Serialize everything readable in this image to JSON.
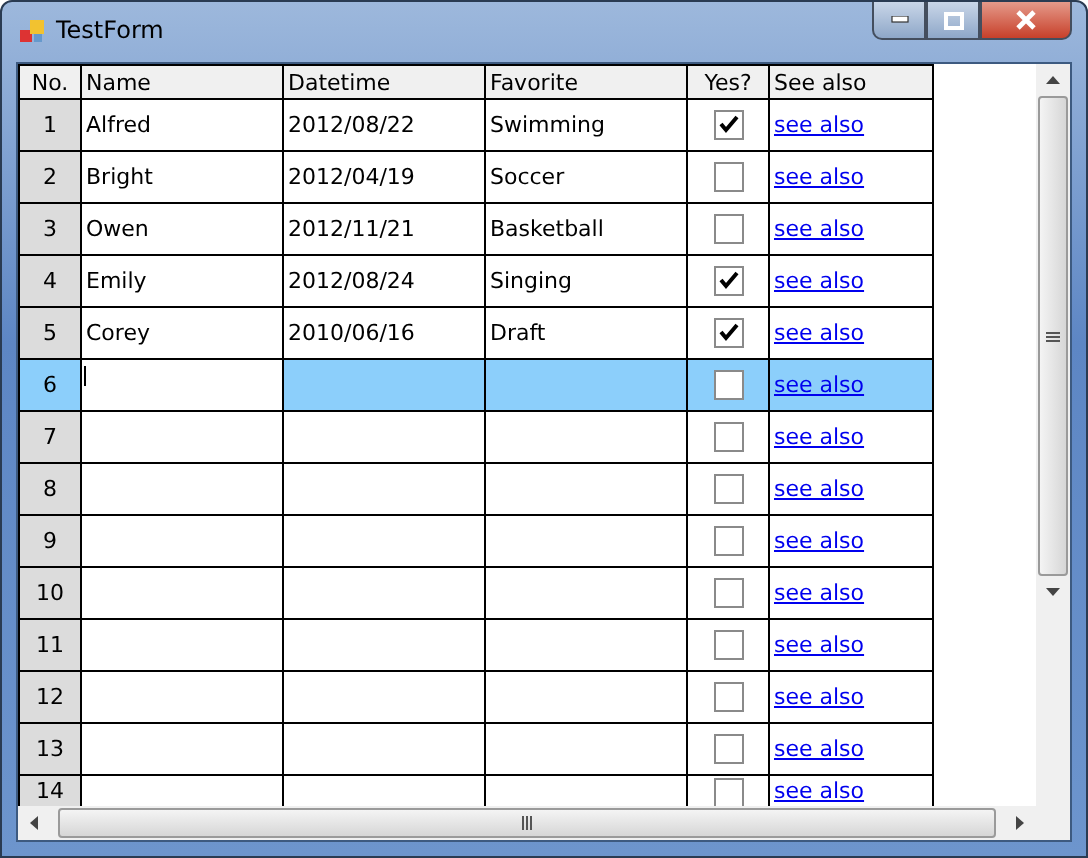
{
  "window": {
    "title": "TestForm"
  },
  "table": {
    "columns": [
      "No.",
      "Name",
      "Datetime",
      "Favorite",
      "Yes?",
      "See also"
    ],
    "rows": [
      {
        "no": "1",
        "name": "Alfred",
        "datetime": "2012/08/22",
        "favorite": "Swimming",
        "checked": true,
        "link": "see also",
        "selected": false
      },
      {
        "no": "2",
        "name": "Bright",
        "datetime": "2012/04/19",
        "favorite": "Soccer",
        "checked": false,
        "link": "see also",
        "selected": false
      },
      {
        "no": "3",
        "name": "Owen",
        "datetime": "2012/11/21",
        "favorite": "Basketball",
        "checked": false,
        "link": "see also",
        "selected": false
      },
      {
        "no": "4",
        "name": "Emily",
        "datetime": "2012/08/24",
        "favorite": "Singing",
        "checked": true,
        "link": "see also",
        "selected": false
      },
      {
        "no": "5",
        "name": "Corey",
        "datetime": "2010/06/16",
        "favorite": "Draft",
        "checked": true,
        "link": "see also",
        "selected": false
      },
      {
        "no": "6",
        "checked": false,
        "link": "see also",
        "selected": true
      },
      {
        "no": "7",
        "checked": false,
        "link": "see also",
        "selected": false
      },
      {
        "no": "8",
        "checked": false,
        "link": "see also",
        "selected": false
      },
      {
        "no": "9",
        "checked": false,
        "link": "see also",
        "selected": false
      },
      {
        "no": "10",
        "checked": false,
        "link": "see also",
        "selected": false
      },
      {
        "no": "11",
        "checked": false,
        "link": "see also",
        "selected": false
      },
      {
        "no": "12",
        "checked": false,
        "link": "see also",
        "selected": false
      },
      {
        "no": "13",
        "checked": false,
        "link": "see also",
        "selected": false
      },
      {
        "no": "14",
        "checked": false,
        "link": "see also",
        "selected": false
      }
    ]
  }
}
